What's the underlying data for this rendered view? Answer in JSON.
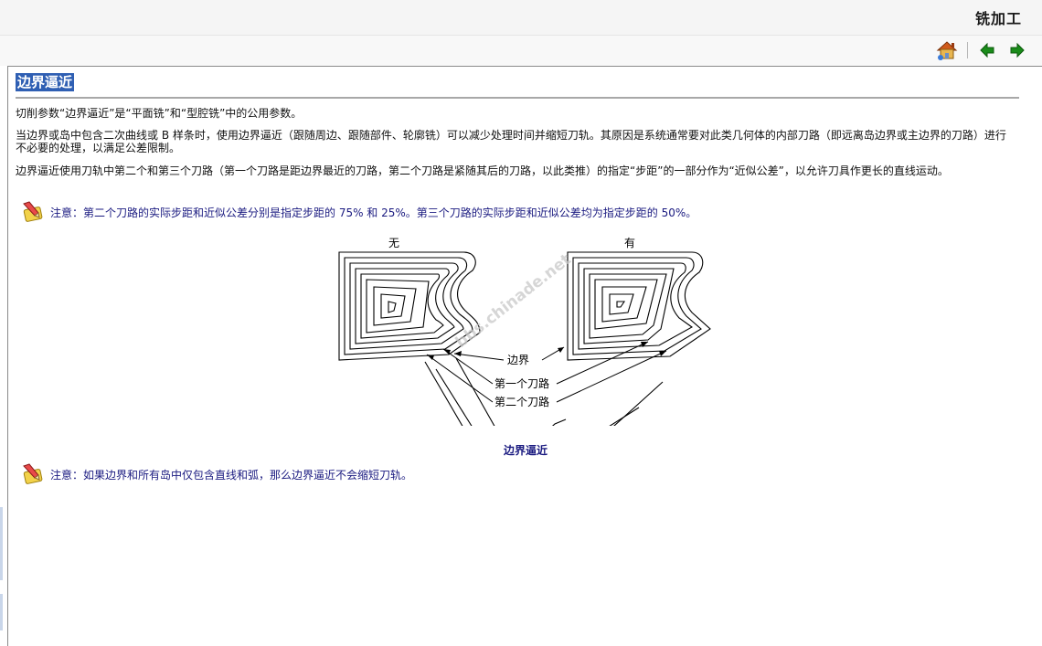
{
  "app": {
    "doc_title": "铣加工"
  },
  "toolbar": {
    "buttons": [
      {
        "name": "home",
        "icon": "home-icon"
      },
      {
        "name": "back",
        "icon": "arrow-left-icon"
      },
      {
        "name": "forward",
        "icon": "arrow-right-icon"
      }
    ],
    "colors": {
      "arrow": "#1a8c1a",
      "house_roof": "#d05a1a",
      "house_wall": "#e8b650"
    }
  },
  "content": {
    "heading": "边界逼近",
    "paragraphs": [
      "切削参数“边界逼近”是“平面铣”和“型腔铣”中的公用参数。",
      "当边界或岛中包含二次曲线或 B 样条时，使用边界逼近（跟随周边、跟随部件、轮廓铣）可以减少处理时间并缩短刀轨。其原因是系统通常要对此类几何体的内部刀路（即远离岛边界或主边界的刀路）进行不必要的处理，以满足公差限制。",
      "边界逼近使用刀轨中第二个和第三个刀路（第一个刀路是距边界最近的刀路，第二个刀路是紧随其后的刀路，以此类推）的指定“步距”的一部分作为“近似公差”，以允许刀具作更长的直线运动。"
    ],
    "notes": [
      "注意：第二个刀路的实际步距和近似公差分别是指定步距的 75% 和 25%。第三个刀路的实际步距和近似公差均为指定步距的 50%。",
      "注意：如果边界和所有岛中仅包含直线和弧，那么边界逼近不会缩短刀轨。"
    ],
    "note_icon": "note-pencil-icon"
  },
  "figure": {
    "label_left": "无",
    "label_right": "有",
    "callouts": {
      "boundary": "边界",
      "first_pass": "第一个刀路",
      "second_pass": "第二个刀路"
    },
    "watermark": "bbs.chinade.net",
    "caption": "边界逼近"
  }
}
